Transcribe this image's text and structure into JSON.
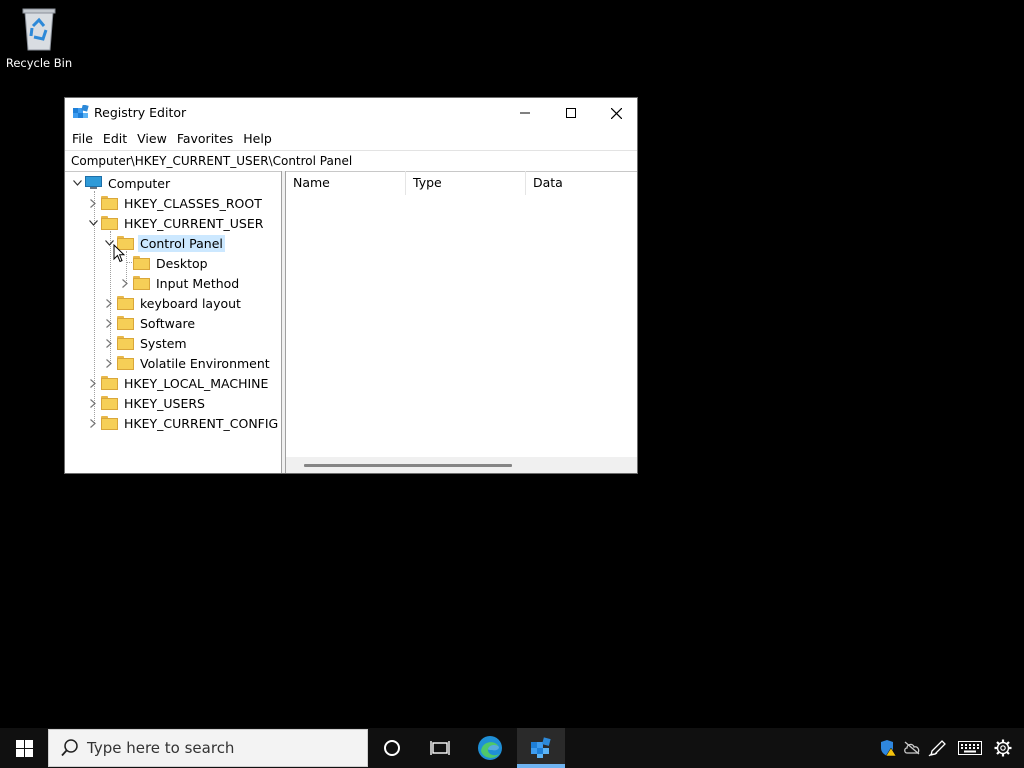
{
  "desktop": {
    "recycle_bin_label": "Recycle Bin"
  },
  "window": {
    "title": "Registry Editor",
    "menu": [
      "File",
      "Edit",
      "View",
      "Favorites",
      "Help"
    ],
    "address": "Computer\\HKEY_CURRENT_USER\\Control Panel",
    "tree": {
      "computer": "Computer",
      "hkcr": "HKEY_CLASSES_ROOT",
      "hkcu": "HKEY_CURRENT_USER",
      "control_panel": "Control Panel",
      "desktop": "Desktop",
      "input_method": "Input Method",
      "keyboard_layout": "keyboard layout",
      "software": "Software",
      "system": "System",
      "volatile_environment": "Volatile Environment",
      "hklm": "HKEY_LOCAL_MACHINE",
      "hku": "HKEY_USERS",
      "hkcc": "HKEY_CURRENT_CONFIG"
    },
    "columns": [
      "Name",
      "Type",
      "Data"
    ]
  },
  "taskbar": {
    "search_placeholder": "Type here to search"
  },
  "colors": {
    "accent": "#0078d7",
    "selection": "#cce8ff",
    "taskbar": "#101010"
  }
}
